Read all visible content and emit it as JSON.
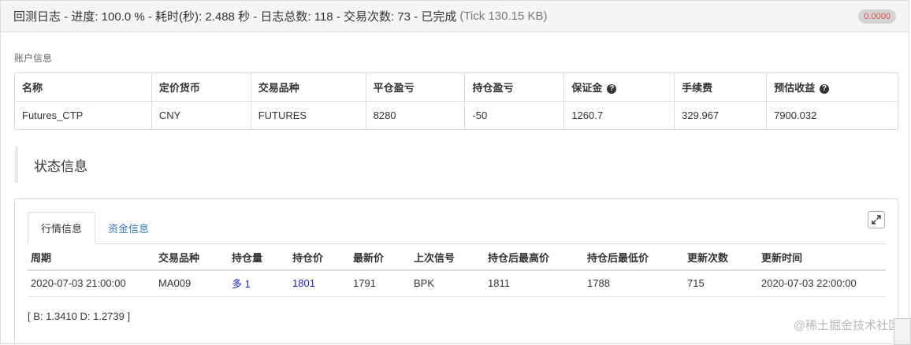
{
  "header": {
    "title": "回测日志 - 进度: 100.0 % - 耗时(秒): 2.488 秒 - 日志总数: 118 - 交易次数: 73 - 已完成",
    "tick_info": "(Tick 130.15 KB)",
    "badge": "0.0000"
  },
  "account": {
    "section_label": "账户信息",
    "columns": [
      "名称",
      "定价货币",
      "交易品种",
      "平仓盈亏",
      "持仓盈亏",
      "保证金",
      "手续费",
      "预估收益"
    ],
    "row": [
      "Futures_CTP",
      "CNY",
      "FUTURES",
      "8280",
      "-50",
      "1260.7",
      "329.967",
      "7900.032"
    ]
  },
  "status": {
    "title": "状态信息",
    "tabs": [
      "行情信息",
      "资金信息"
    ],
    "active_tab": "行情信息",
    "columns": [
      "周期",
      "交易品种",
      "持仓量",
      "持仓价",
      "最新价",
      "上次信号",
      "持仓后最高价",
      "持仓后最低价",
      "更新次数",
      "更新时间"
    ],
    "row": [
      "2020-07-03 21:00:00",
      "MA009",
      "多 1",
      "1801",
      "1791",
      "BPK",
      "1811",
      "1788",
      "715",
      "2020-07-03 22:00:00"
    ],
    "note": "[ B: 1.3410 D: 1.2739 ]"
  },
  "watermark": "@稀土掘金技术社区",
  "icons": {
    "help": "question-circle-icon",
    "expand": "expand-icon"
  },
  "colors": {
    "link": "#337ab7",
    "position_value": "#1f1fbf",
    "badge_text": "#d9534f"
  }
}
